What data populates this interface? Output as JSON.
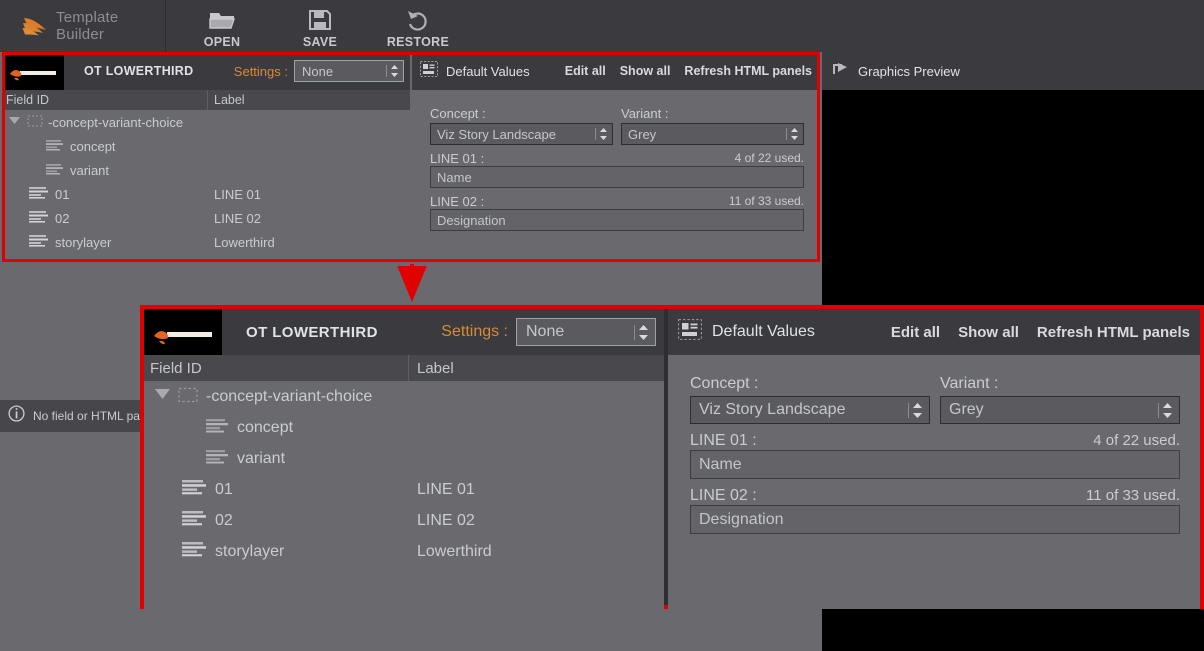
{
  "app": {
    "title": "Template Builder",
    "logo_icon": "viz-feather-logo",
    "accent_color": "#d98b34",
    "annotation_color": "#e00000",
    "panel_bg": "#6a6a6e",
    "header_bg": "#3a3a3f"
  },
  "toolbar": {
    "buttons": [
      {
        "label": "OPEN",
        "icon": "folder-open-icon"
      },
      {
        "label": "SAVE",
        "icon": "floppy-disk-icon"
      },
      {
        "label": "RESTORE",
        "icon": "undo-arrow-icon"
      }
    ]
  },
  "template_panel": {
    "thumbnail_icon": "template-thumbnail",
    "title": "OT LOWERTHIRD",
    "settings_label": "Settings :",
    "settings_value": "None",
    "columns": {
      "field_id": "Field ID",
      "label": "Label"
    },
    "rows": [
      {
        "icon": "folder-dashed-icon",
        "expander": "triangle-down-icon",
        "field_id": "-concept-variant-choice",
        "label": "",
        "indent": 0
      },
      {
        "icon": "text-lines-icon",
        "expander": "",
        "field_id": "concept",
        "label": "",
        "indent": 2
      },
      {
        "icon": "text-lines-icon",
        "expander": "",
        "field_id": "variant",
        "label": "",
        "indent": 2
      },
      {
        "icon": "text-lines-icon",
        "expander": "",
        "field_id": "01",
        "label": "LINE 01",
        "indent": 1
      },
      {
        "icon": "text-lines-icon",
        "expander": "",
        "field_id": "02",
        "label": "LINE 02",
        "indent": 1
      },
      {
        "icon": "text-lines-icon",
        "expander": "",
        "field_id": "storylayer",
        "label": "Lowerthird",
        "indent": 1
      }
    ]
  },
  "default_values_panel": {
    "icon": "default-values-icon",
    "title": "Default Values",
    "links": [
      {
        "label": "Edit all"
      },
      {
        "label": "Show all"
      },
      {
        "label": "Refresh HTML panels"
      }
    ],
    "fields": [
      {
        "type": "select",
        "label": "Concept :",
        "value": "Viz Story Landscape",
        "counter": ""
      },
      {
        "type": "select",
        "label": "Variant :",
        "value": "Grey",
        "counter": ""
      },
      {
        "type": "text",
        "label": "LINE 01 :",
        "value": "Name",
        "counter": "4 of 22 used."
      },
      {
        "type": "text",
        "label": "LINE 02 :",
        "value": "Designation",
        "counter": "11 of 33 used."
      }
    ]
  },
  "graphics_preview_panel": {
    "icon": "graphics-preview-icon",
    "title": "Graphics Preview"
  },
  "status_bar": {
    "icon": "info-icon",
    "message": "No field or HTML panel"
  }
}
